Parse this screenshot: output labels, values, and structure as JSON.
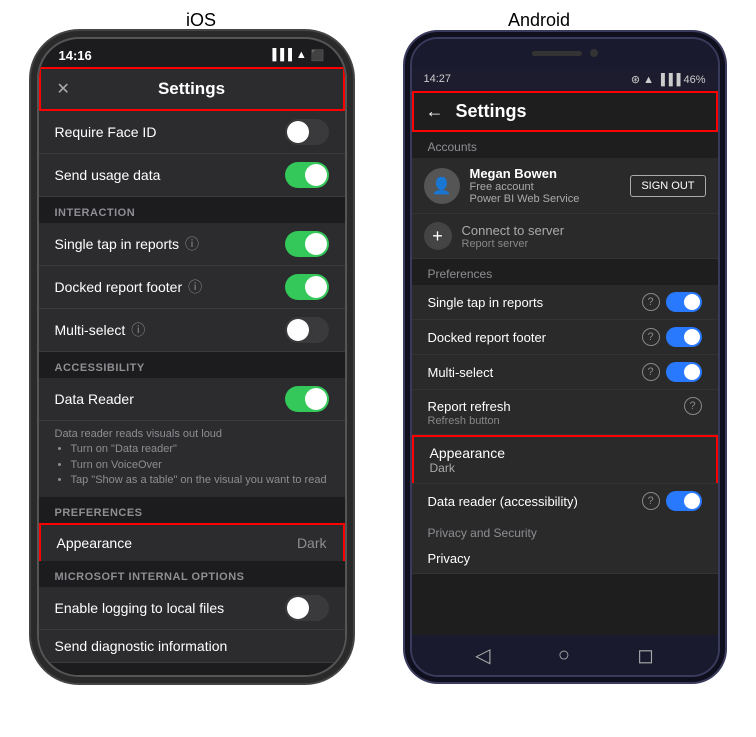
{
  "platforms": {
    "ios_label": "iOS",
    "android_label": "Android"
  },
  "ios": {
    "status_time": "14:16",
    "header_title": "Settings",
    "close_btn": "✕",
    "rows": [
      {
        "label": "Require Face ID",
        "toggle": "off",
        "has_question": false
      },
      {
        "label": "Send usage data",
        "toggle": "on",
        "has_question": false
      }
    ],
    "interaction_section": "INTERACTION",
    "interaction_rows": [
      {
        "label": "Single tap in reports",
        "toggle": "on",
        "has_question": true
      },
      {
        "label": "Docked report footer",
        "toggle": "on",
        "has_question": true
      },
      {
        "label": "Multi-select",
        "toggle": "off",
        "has_question": true
      }
    ],
    "accessibility_section": "ACCESSIBILITY",
    "data_reader_label": "Data Reader",
    "data_reader_toggle": "on",
    "data_reader_desc": [
      "Data reader reads visuals out loud",
      "Turn on \"Data reader\"",
      "Turn on VoiceOver",
      "Tap \"Show as a table\" on the visual you want to read"
    ],
    "preferences_section": "PREFERENCES",
    "appearance_label": "Appearance",
    "appearance_value": "Dark",
    "microsoft_section": "MICROSOFT INTERNAL OPTIONS",
    "microsoft_rows": [
      {
        "label": "Enable logging to local files",
        "toggle": "off"
      },
      {
        "label": "Send diagnostic information",
        "no_toggle": true
      }
    ]
  },
  "android": {
    "status_time": "14:27",
    "header_title": "Settings",
    "back_btn": "←",
    "accounts_label": "Accounts",
    "account_name": "Megan Bowen",
    "account_type": "Free account",
    "account_service": "Power BI Web Service",
    "sign_out_label": "SIGN OUT",
    "connect_label": "Connect to server",
    "connect_sub": "Report server",
    "preferences_label": "Preferences",
    "pref_rows": [
      {
        "label": "Single tap in reports",
        "toggle": true,
        "has_question": true
      },
      {
        "label": "Docked report footer",
        "toggle": true,
        "has_question": true
      },
      {
        "label": "Multi-select",
        "toggle": true,
        "has_question": true
      }
    ],
    "report_refresh_label": "Report refresh",
    "report_refresh_sub": "Refresh button",
    "report_refresh_has_question": true,
    "appearance_label": "Appearance",
    "appearance_value": "Dark",
    "data_reader_label": "Data reader (accessibility)",
    "data_reader_toggle": true,
    "data_reader_has_question": true,
    "privacy_label": "Privacy and Security",
    "privacy_row": "Privacy"
  }
}
